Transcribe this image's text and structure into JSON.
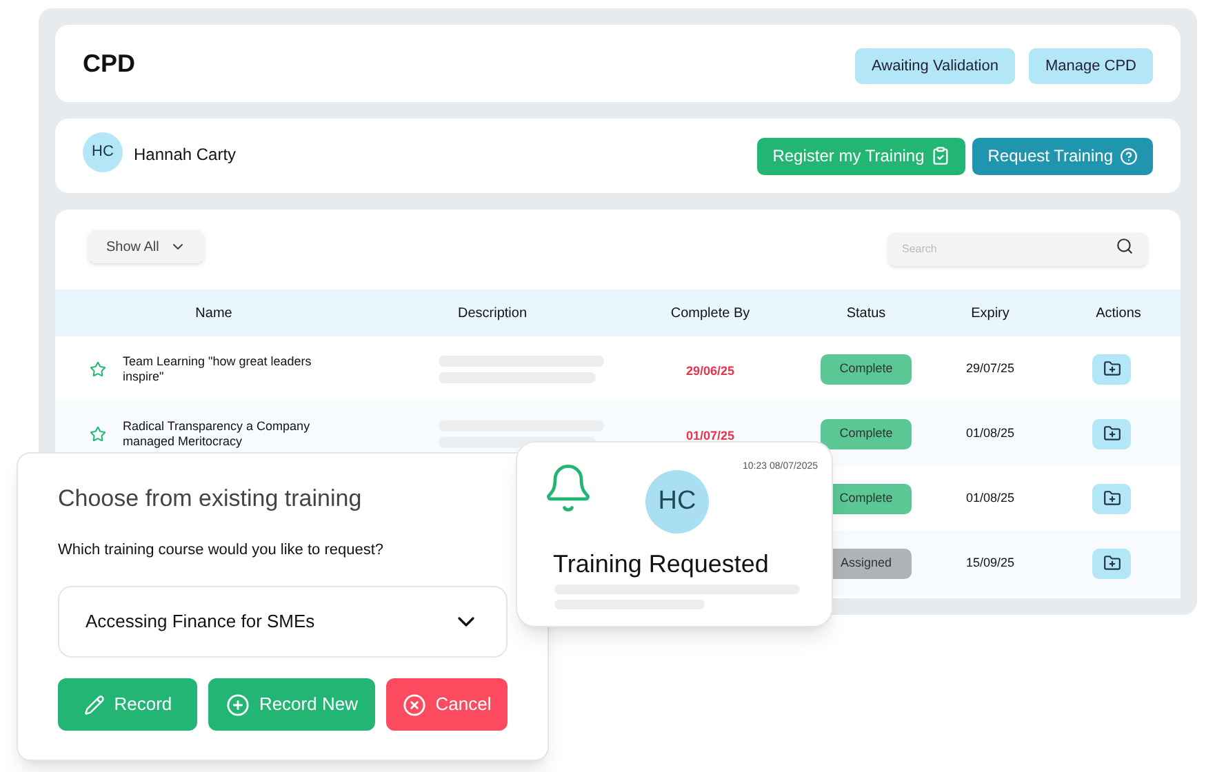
{
  "header": {
    "title": "CPD",
    "buttons": [
      "Awaiting Validation",
      "Manage CPD"
    ]
  },
  "user": {
    "initials": "HC",
    "name": "Hannah Carty",
    "actions": [
      {
        "label": "Register my Training",
        "kind": "register"
      },
      {
        "label": "Request Training",
        "kind": "request"
      }
    ]
  },
  "toolbar": {
    "filter": "Show All",
    "search": {
      "placeholder": "Search"
    }
  },
  "table": {
    "columns": [
      "Name",
      "Description",
      "Complete By",
      "Status",
      "Expiry",
      "Actions"
    ],
    "rows": [
      {
        "name": "Team Learning \"how great leaders inspire\"",
        "complete_by": "29/06/25",
        "status": "Complete",
        "kind": "complete",
        "expiry": "29/07/25"
      },
      {
        "name": "Radical Transparency a Company managed Meritocracy",
        "complete_by": "01/07/25",
        "status": "Complete",
        "kind": "complete",
        "expiry": "01/08/25"
      },
      {
        "status": "Complete",
        "kind": "complete",
        "expiry": "01/08/25"
      },
      {
        "status": "Assigned",
        "kind": "assigned",
        "expiry": "15/09/25"
      }
    ]
  },
  "dialog": {
    "title": "Choose from existing training",
    "question": "Which training course would you like to request?",
    "selection": "Accessing Finance for SMEs",
    "buttons": [
      {
        "label": "Record",
        "kind": "record"
      },
      {
        "label": "Record New",
        "kind": "record_new"
      },
      {
        "label": "Cancel",
        "kind": "cancel"
      }
    ]
  },
  "notification": {
    "time": "10:23 08/07/2025",
    "initials": "HC",
    "title": "Training Requested"
  }
}
